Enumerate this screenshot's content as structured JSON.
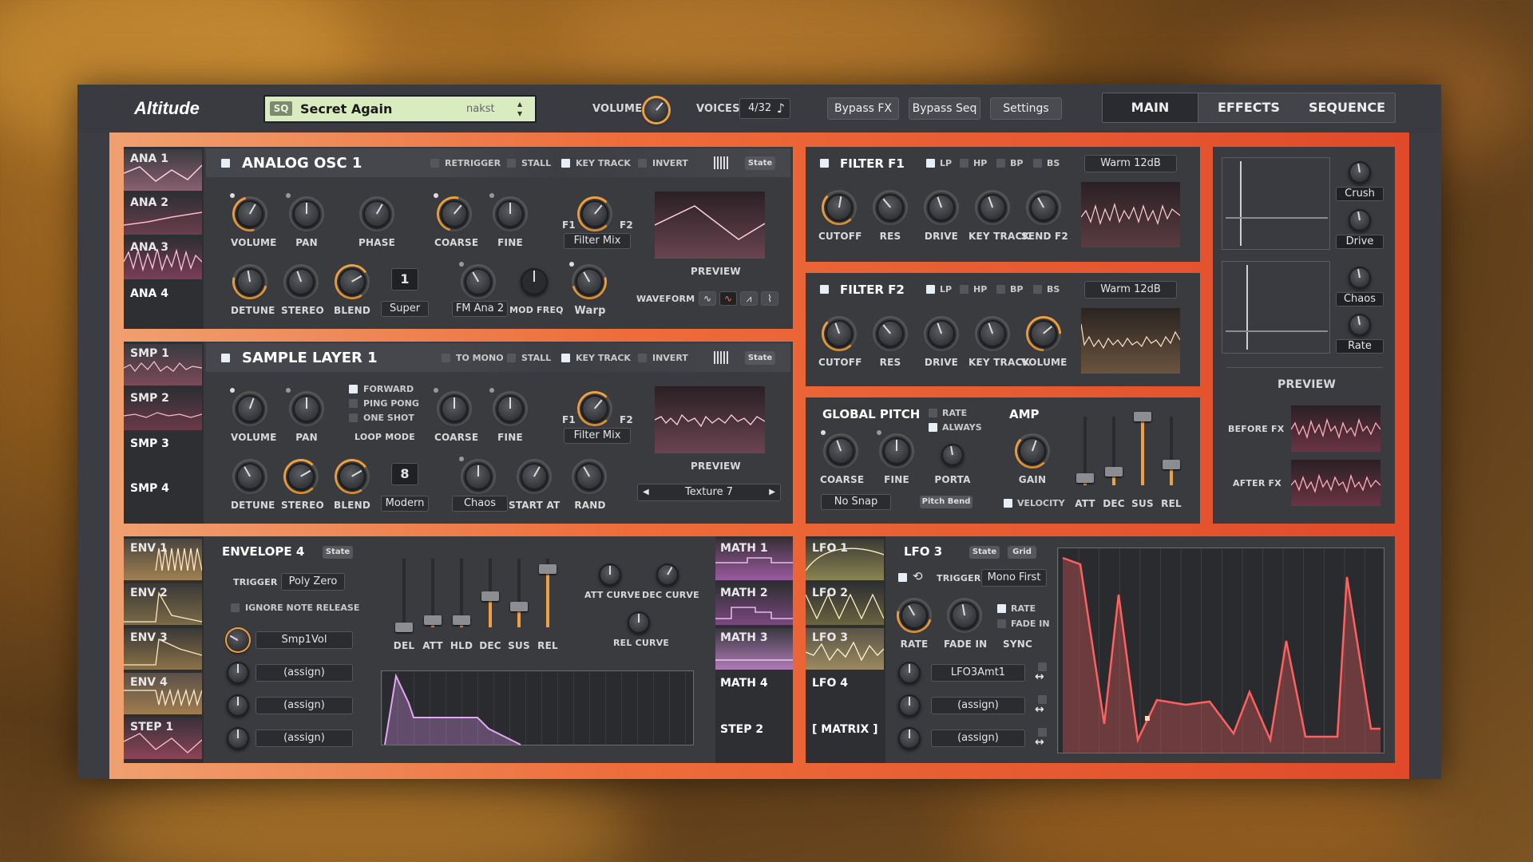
{
  "app": {
    "title": "Altitude"
  },
  "preset": {
    "tag": "SQ",
    "name": "Secret Again",
    "author": "nakst"
  },
  "header": {
    "volume_label": "VOLUME",
    "voices_label": "VOICES",
    "voices_value": "4/32",
    "voices_note": "♪",
    "buttons": [
      "Bypass FX",
      "Bypass Seq",
      "Settings"
    ],
    "tabs": [
      "MAIN",
      "EFFECTS",
      "SEQUENCE"
    ]
  },
  "osc": {
    "sidebar": [
      "ANA 1",
      "ANA 2",
      "ANA 3",
      "ANA 4"
    ],
    "title": "ANALOG OSC 1",
    "flags": [
      "RETRIGGER",
      "STALL",
      "KEY TRACK",
      "INVERT"
    ],
    "state": "State",
    "row1": [
      "VOLUME",
      "PAN",
      "PHASE",
      "COARSE",
      "FINE"
    ],
    "row2": [
      "DETUNE",
      "STEREO",
      "BLEND"
    ],
    "unison_count": "1",
    "unison_mode": "Super",
    "fm_source": "FM Ana 2",
    "mod_freq": "MOD FREQ",
    "warp": "Warp",
    "f1": "F1",
    "f2": "F2",
    "filter_mix": "Filter Mix",
    "preview": "PREVIEW",
    "waveform": "WAVEFORM",
    "waveform_icons": [
      "∿",
      "∿",
      "⩘",
      "⌇"
    ]
  },
  "sample": {
    "sidebar": [
      "SMP 1",
      "SMP 2",
      "SMP 3",
      "SMP 4"
    ],
    "title": "SAMPLE LAYER 1",
    "flags": [
      "TO MONO",
      "STALL",
      "KEY TRACK",
      "INVERT"
    ],
    "state": "State",
    "row1": [
      "VOLUME",
      "PAN",
      "COARSE",
      "FINE"
    ],
    "loop_modes": [
      "FORWARD",
      "PING PONG",
      "ONE SHOT"
    ],
    "loop_mode_label": "LOOP MODE",
    "row2": [
      "DETUNE",
      "STEREO",
      "BLEND"
    ],
    "unison_count": "8",
    "unison_mode": "Modern",
    "chaos": "Chaos",
    "start_at": "START AT",
    "rand": "RAND",
    "f1": "F1",
    "f2": "F2",
    "filter_mix": "Filter Mix",
    "preview": "PREVIEW",
    "texture": "Texture 7"
  },
  "filter1": {
    "title": "FILTER F1",
    "modes": [
      "LP",
      "HP",
      "BP",
      "BS"
    ],
    "type": "Warm 12dB",
    "knobs": [
      "CUTOFF",
      "RES",
      "DRIVE",
      "KEY TRACK",
      "SEND F2"
    ]
  },
  "filter2": {
    "title": "FILTER F2",
    "modes": [
      "LP",
      "HP",
      "BP",
      "BS"
    ],
    "type": "Warm 12dB",
    "knobs": [
      "CUTOFF",
      "RES",
      "DRIVE",
      "KEY TRACK",
      "VOLUME"
    ]
  },
  "pitch": {
    "title": "GLOBAL PITCH",
    "rate": "RATE",
    "always": "ALWAYS",
    "knobs": [
      "COARSE",
      "FINE",
      "PORTA"
    ],
    "snap": "No Snap",
    "pitch_bend": "Pitch Bend"
  },
  "amp": {
    "title": "AMP",
    "gain": "GAIN",
    "velocity": "VELOCITY",
    "sliders": [
      "ATT",
      "DEC",
      "SUS",
      "REL"
    ],
    "slider_levels": [
      0.1,
      0.2,
      1.0,
      0.3
    ]
  },
  "fx": {
    "crush": "Crush",
    "drive": "Drive",
    "chaos": "Chaos",
    "rate": "Rate",
    "preview": "PREVIEW",
    "before": "BEFORE FX",
    "after": "AFTER FX"
  },
  "env": {
    "sidebar": [
      "ENV 1",
      "ENV 2",
      "ENV 3",
      "ENV 4",
      "STEP 1"
    ],
    "title": "ENVELOPE 4",
    "state": "State",
    "trigger_label": "TRIGGER",
    "trigger": "Poly Zero",
    "ignore": "IGNORE NOTE RELEASE",
    "assign": [
      "Smp1Vol",
      "(assign)",
      "(assign)",
      "(assign)"
    ],
    "sliders": [
      "DEL",
      "ATT",
      "HLD",
      "DEC",
      "SUS",
      "REL"
    ],
    "slider_levels": [
      0.0,
      0.1,
      0.1,
      0.45,
      0.3,
      0.85
    ],
    "curves": [
      "ATT CURVE",
      "DEC CURVE",
      "REL CURVE"
    ]
  },
  "math": {
    "sidebar": [
      "MATH 1",
      "MATH 2",
      "MATH 3",
      "MATH 4",
      "STEP 2"
    ]
  },
  "lfo": {
    "sidebar": [
      "LFO 1",
      "LFO 2",
      "LFO 3",
      "LFO 4",
      "[ MATRIX ]"
    ],
    "title": "LFO 3",
    "state": "State",
    "grid": "Grid",
    "trigger_label": "TRIGGER",
    "trigger": "Mono First",
    "knobs": [
      "RATE",
      "FADE IN",
      "SYNC"
    ],
    "flags": [
      "RATE",
      "FADE IN"
    ],
    "assign": [
      "LFO3Amt1",
      "(assign)",
      "(assign)"
    ],
    "arrow": "↔"
  },
  "colors": {
    "accent": "#f0a040",
    "frame": "#e0503a"
  }
}
